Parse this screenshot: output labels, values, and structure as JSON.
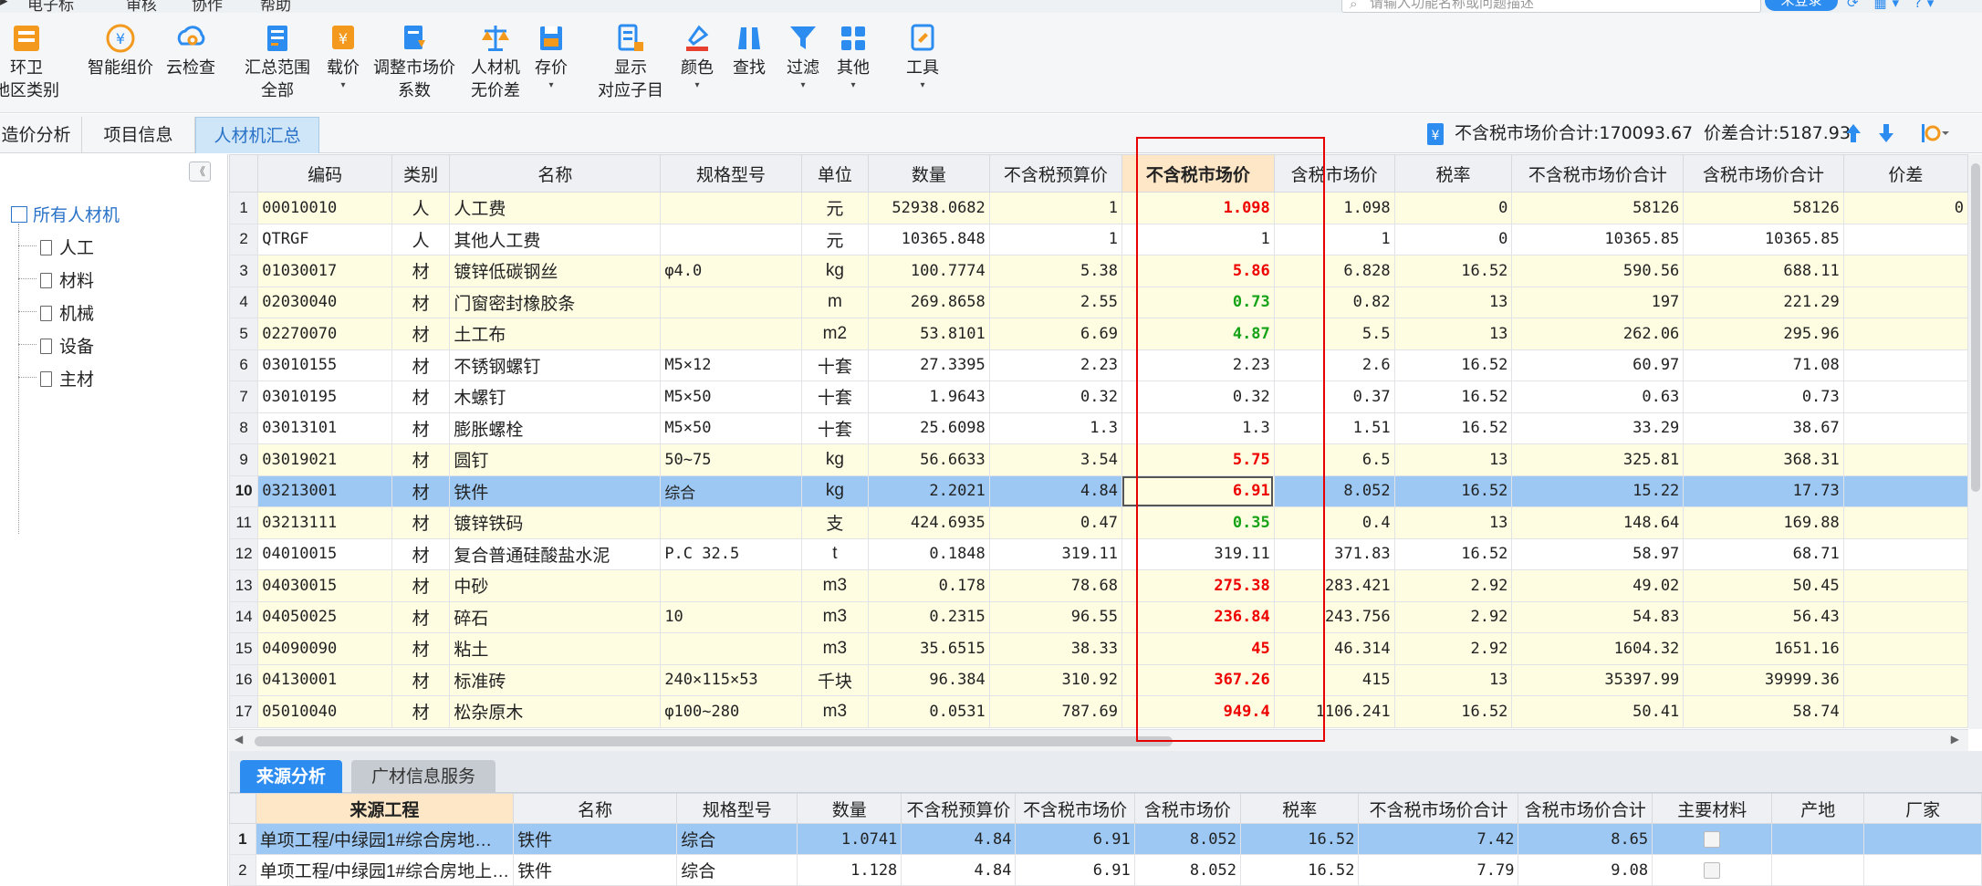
{
  "menubar": {
    "items": [
      "电子标",
      "审核",
      "协作",
      "帮助"
    ],
    "search_placeholder": "请输入功能名称或问题描述",
    "login_label": "未登录"
  },
  "ribbon": {
    "buttons": [
      {
        "label": "环卫",
        "label2": "地区类别",
        "icon": "building-icon"
      },
      {
        "label": "智能组价",
        "icon": "smart-price-icon"
      },
      {
        "label": "云检查",
        "icon": "cloud-check-icon"
      },
      {
        "label": "汇总范围",
        "label2": "全部",
        "icon": "summary-range-icon"
      },
      {
        "label": "载价",
        "icon": "load-price-icon",
        "caret": "▾"
      },
      {
        "label": "调整市场价",
        "label2": "系数",
        "icon": "adjust-price-icon"
      },
      {
        "label": "人材机",
        "label2": "无价差",
        "icon": "balance-icon"
      },
      {
        "label": "存价",
        "icon": "save-price-icon",
        "caret": "▾"
      },
      {
        "label": "显示",
        "label2": "对应子目",
        "icon": "show-items-icon"
      },
      {
        "label": "颜色",
        "icon": "color-icon",
        "caret": "▾"
      },
      {
        "label": "查找",
        "icon": "binoculars-icon"
      },
      {
        "label": "过滤",
        "icon": "filter-icon",
        "caret": "▾"
      },
      {
        "label": "其他",
        "icon": "grid-icon",
        "caret": "▾"
      },
      {
        "label": "工具",
        "icon": "tools-icon",
        "caret": "▾"
      }
    ]
  },
  "tabs": [
    {
      "label": "造价分析"
    },
    {
      "label": "项目信息"
    },
    {
      "label": "人材机汇总",
      "active": true
    }
  ],
  "summary": {
    "text1": "不含税市场价合计:170093.67",
    "text2": "价差合计:5187.93"
  },
  "tree": {
    "root": "所有人材机",
    "children": [
      "人工",
      "材料",
      "机械",
      "设备",
      "主材"
    ]
  },
  "main_grid": {
    "headers": [
      "编码",
      "类别",
      "名称",
      "规格型号",
      "单位",
      "数量",
      "不含税预算价",
      "不含税市场价",
      "含税市场价",
      "税率",
      "不含税市场价合计",
      "含税市场价合计",
      "价差"
    ],
    "rows": [
      {
        "no": "1",
        "code": "00010010",
        "type": "人",
        "name": "人工费",
        "spec": "",
        "unit": "元",
        "qty": "52938.0682",
        "budget": "1",
        "market": "1.098",
        "taxmarket": "1.098",
        "rate": "0",
        "total": "58126",
        "taxtotal": "58126",
        "diff": "0",
        "mclass": "red",
        "row": "y"
      },
      {
        "no": "2",
        "code": "QTRGF",
        "type": "人",
        "name": "其他人工费",
        "spec": "",
        "unit": "元",
        "qty": "10365.848",
        "budget": "1",
        "market": "1",
        "taxmarket": "1",
        "rate": "0",
        "total": "10365.85",
        "taxtotal": "10365.85",
        "diff": "",
        "mclass": "",
        "row": "w"
      },
      {
        "no": "3",
        "code": "01030017",
        "type": "材",
        "name": "镀锌低碳钢丝",
        "spec": "φ4.0",
        "unit": "kg",
        "qty": "100.7774",
        "budget": "5.38",
        "market": "5.86",
        "taxmarket": "6.828",
        "rate": "16.52",
        "total": "590.56",
        "taxtotal": "688.11",
        "diff": "",
        "mclass": "red",
        "row": "y"
      },
      {
        "no": "4",
        "code": "02030040",
        "type": "材",
        "name": "门窗密封橡胶条",
        "spec": "",
        "unit": "m",
        "qty": "269.8658",
        "budget": "2.55",
        "market": "0.73",
        "taxmarket": "0.82",
        "rate": "13",
        "total": "197",
        "taxtotal": "221.29",
        "diff": "",
        "mclass": "green",
        "row": "y"
      },
      {
        "no": "5",
        "code": "02270070",
        "type": "材",
        "name": "土工布",
        "spec": "",
        "unit": "m2",
        "qty": "53.8101",
        "budget": "6.69",
        "market": "4.87",
        "taxmarket": "5.5",
        "rate": "13",
        "total": "262.06",
        "taxtotal": "295.96",
        "diff": "",
        "mclass": "green",
        "row": "y"
      },
      {
        "no": "6",
        "code": "03010155",
        "type": "材",
        "name": "不锈钢螺钉",
        "spec": "M5×12",
        "unit": "十套",
        "qty": "27.3395",
        "budget": "2.23",
        "market": "2.23",
        "taxmarket": "2.6",
        "rate": "16.52",
        "total": "60.97",
        "taxtotal": "71.08",
        "diff": "",
        "mclass": "",
        "row": "w"
      },
      {
        "no": "7",
        "code": "03010195",
        "type": "材",
        "name": "木螺钉",
        "spec": "M5×50",
        "unit": "十套",
        "qty": "1.9643",
        "budget": "0.32",
        "market": "0.32",
        "taxmarket": "0.37",
        "rate": "16.52",
        "total": "0.63",
        "taxtotal": "0.73",
        "diff": "",
        "mclass": "",
        "row": "w"
      },
      {
        "no": "8",
        "code": "03013101",
        "type": "材",
        "name": "膨胀螺栓",
        "spec": "M5×50",
        "unit": "十套",
        "qty": "25.6098",
        "budget": "1.3",
        "market": "1.3",
        "taxmarket": "1.51",
        "rate": "16.52",
        "total": "33.29",
        "taxtotal": "38.67",
        "diff": "",
        "mclass": "",
        "row": "w"
      },
      {
        "no": "9",
        "code": "03019021",
        "type": "材",
        "name": "圆钉",
        "spec": "50~75",
        "unit": "kg",
        "qty": "56.6633",
        "budget": "3.54",
        "market": "5.75",
        "taxmarket": "6.5",
        "rate": "13",
        "total": "325.81",
        "taxtotal": "368.31",
        "diff": "",
        "mclass": "red",
        "row": "y"
      },
      {
        "no": "10",
        "code": "03213001",
        "type": "材",
        "name": "铁件",
        "spec": "综合",
        "unit": "kg",
        "qty": "2.2021",
        "budget": "4.84",
        "market": "6.91",
        "taxmarket": "8.052",
        "rate": "16.52",
        "total": "15.22",
        "taxtotal": "17.73",
        "diff": "",
        "mclass": "red",
        "row": "sel"
      },
      {
        "no": "11",
        "code": "03213111",
        "type": "材",
        "name": "镀锌铁码",
        "spec": "",
        "unit": "支",
        "qty": "424.6935",
        "budget": "0.47",
        "market": "0.35",
        "taxmarket": "0.4",
        "rate": "13",
        "total": "148.64",
        "taxtotal": "169.88",
        "diff": "",
        "mclass": "green",
        "row": "y"
      },
      {
        "no": "12",
        "code": "04010015",
        "type": "材",
        "name": "复合普通硅酸盐水泥",
        "spec": "P.C 32.5",
        "unit": "t",
        "qty": "0.1848",
        "budget": "319.11",
        "market": "319.11",
        "taxmarket": "371.83",
        "rate": "16.52",
        "total": "58.97",
        "taxtotal": "68.71",
        "diff": "",
        "mclass": "",
        "row": "w"
      },
      {
        "no": "13",
        "code": "04030015",
        "type": "材",
        "name": "中砂",
        "spec": "",
        "unit": "m3",
        "qty": "0.178",
        "budget": "78.68",
        "market": "275.38",
        "taxmarket": "283.421",
        "rate": "2.92",
        "total": "49.02",
        "taxtotal": "50.45",
        "diff": "",
        "mclass": "red",
        "row": "y"
      },
      {
        "no": "14",
        "code": "04050025",
        "type": "材",
        "name": "碎石",
        "spec": "10",
        "unit": "m3",
        "qty": "0.2315",
        "budget": "96.55",
        "market": "236.84",
        "taxmarket": "243.756",
        "rate": "2.92",
        "total": "54.83",
        "taxtotal": "56.43",
        "diff": "",
        "mclass": "red",
        "row": "y"
      },
      {
        "no": "15",
        "code": "04090090",
        "type": "材",
        "name": "粘土",
        "spec": "",
        "unit": "m3",
        "qty": "35.6515",
        "budget": "38.33",
        "market": "45",
        "taxmarket": "46.314",
        "rate": "2.92",
        "total": "1604.32",
        "taxtotal": "1651.16",
        "diff": "",
        "mclass": "red",
        "row": "y"
      },
      {
        "no": "16",
        "code": "04130001",
        "type": "材",
        "name": "标准砖",
        "spec": "240×115×53",
        "unit": "千块",
        "qty": "96.384",
        "budget": "310.92",
        "market": "367.26",
        "taxmarket": "415",
        "rate": "13",
        "total": "35397.99",
        "taxtotal": "39999.36",
        "diff": "",
        "mclass": "red",
        "row": "y"
      },
      {
        "no": "17",
        "code": "05010040",
        "type": "材",
        "name": "松杂原木",
        "spec": "φ100~280",
        "unit": "m3",
        "qty": "0.0531",
        "budget": "787.69",
        "market": "949.4",
        "taxmarket": "1106.241",
        "rate": "16.52",
        "total": "50.41",
        "taxtotal": "58.74",
        "diff": "",
        "mclass": "red",
        "row": "y"
      }
    ]
  },
  "bottom": {
    "tabs": [
      "来源分析",
      "广材信息服务"
    ],
    "headers": [
      "来源工程",
      "名称",
      "规格型号",
      "数量",
      "不含税预算价",
      "不含税市场价",
      "含税市场价",
      "税率",
      "不含税市场价合计",
      "含税市场价合计",
      "主要材料",
      "产地",
      "厂家"
    ],
    "rows": [
      {
        "no": "1",
        "src": "单项工程/中绿园1#综合房地…",
        "name": "铁件",
        "spec": "综合",
        "qty": "1.0741",
        "budget": "4.84",
        "market": "6.91",
        "taxmarket": "8.052",
        "rate": "16.52",
        "total": "7.42",
        "taxtotal": "8.65",
        "sel": true
      },
      {
        "no": "2",
        "src": "单项工程/中绿园1#综合房地上…",
        "name": "铁件",
        "spec": "综合",
        "qty": "1.128",
        "budget": "4.84",
        "market": "6.91",
        "taxmarket": "8.052",
        "rate": "16.52",
        "total": "7.79",
        "taxtotal": "9.08",
        "sel": false
      }
    ]
  },
  "colors": {
    "accent": "#2d8cf0",
    "selected_row": "#9cc8f3",
    "highlight_row": "#fefde2",
    "price_up": "#ee0000",
    "price_down": "#17a317",
    "frame": "#e60000"
  }
}
